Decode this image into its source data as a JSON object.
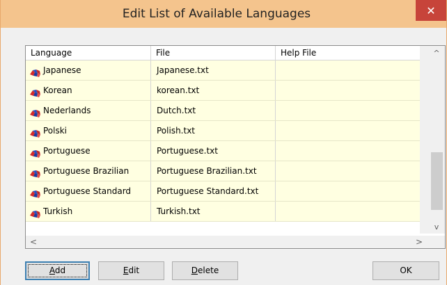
{
  "window": {
    "title": "Edit List of Available Languages",
    "close_label": "✕"
  },
  "table": {
    "columns": [
      "Language",
      "File",
      "Help File"
    ],
    "rows": [
      {
        "language": "Japanese",
        "file": "Japanese.txt",
        "help_file": ""
      },
      {
        "language": "Korean",
        "file": "korean.txt",
        "help_file": ""
      },
      {
        "language": "Nederlands",
        "file": "Dutch.txt",
        "help_file": ""
      },
      {
        "language": "Polski",
        "file": "Polish.txt",
        "help_file": ""
      },
      {
        "language": "Portuguese",
        "file": "Portuguese.txt",
        "help_file": ""
      },
      {
        "language": "Portuguese Brazilian",
        "file": "Portuguese Brazilian.txt",
        "help_file": ""
      },
      {
        "language": "Portuguese Standard",
        "file": "Portuguese Standard.txt",
        "help_file": ""
      },
      {
        "language": "Turkish",
        "file": "Turkish.txt",
        "help_file": ""
      }
    ],
    "row_background": "#ffffe1",
    "icon": "language-flags-icon"
  },
  "scrollbars": {
    "up_arrow": "^",
    "down_arrow": "v",
    "left_arrow": "<",
    "right_arrow": ">"
  },
  "buttons": {
    "add": {
      "pre": "",
      "accel": "A",
      "post": "dd"
    },
    "edit": {
      "pre": "",
      "accel": "E",
      "post": "dit"
    },
    "delete": {
      "pre": "",
      "accel": "D",
      "post": "elete"
    },
    "ok": "OK"
  },
  "colors": {
    "titlebar": "#f4c48d",
    "close_button": "#c7443a"
  }
}
